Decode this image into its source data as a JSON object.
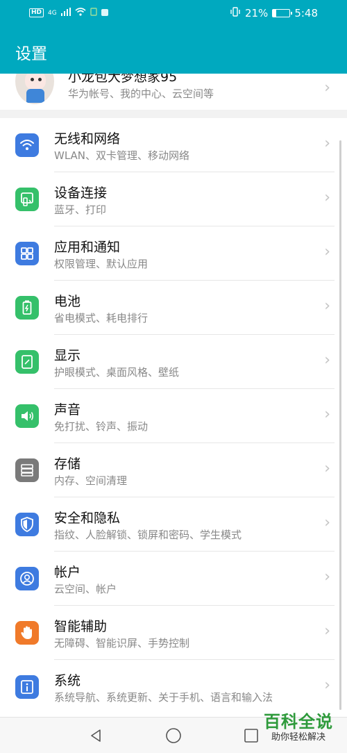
{
  "status_bar": {
    "hd": "HD",
    "network": "4G",
    "signal_icon": "signal-bars-icon",
    "wifi_icon": "wifi-icon",
    "vibrate_icon": "vibrate-icon",
    "battery_text": "21%",
    "battery_level": 0.21,
    "time": "5:48"
  },
  "app_bar": {
    "title": "设置"
  },
  "account": {
    "name": "小龙包大梦想家95",
    "subtitle": "华为帐号、我的中心、云空间等"
  },
  "menu": [
    {
      "label": "无线和网络",
      "sub": "WLAN、双卡管理、移动网络",
      "icon": "wifi-icon",
      "color": "#3e7be0"
    },
    {
      "label": "设备连接",
      "sub": "蓝牙、打印",
      "icon": "device-connection-icon",
      "color": "#35c06a"
    },
    {
      "label": "应用和通知",
      "sub": "权限管理、默认应用",
      "icon": "apps-grid-icon",
      "color": "#3e7be0"
    },
    {
      "label": "电池",
      "sub": "省电模式、耗电排行",
      "icon": "battery-icon",
      "color": "#35c06a"
    },
    {
      "label": "显示",
      "sub": "护眼模式、桌面风格、壁纸",
      "icon": "display-icon",
      "color": "#35c06a"
    },
    {
      "label": "声音",
      "sub": "免打扰、铃声、振动",
      "icon": "speaker-icon",
      "color": "#35c06a"
    },
    {
      "label": "存储",
      "sub": "内存、空间清理",
      "icon": "storage-icon",
      "color": "#7a7a7a"
    },
    {
      "label": "安全和隐私",
      "sub": "指纹、人脸解锁、锁屏和密码、学生模式",
      "icon": "shield-icon",
      "color": "#3e7be0"
    },
    {
      "label": "帐户",
      "sub": "云空间、帐户",
      "icon": "user-icon",
      "color": "#3e7be0"
    },
    {
      "label": "智能辅助",
      "sub": "无障碍、智能识屏、手势控制",
      "icon": "hand-icon",
      "color": "#f07a2a"
    },
    {
      "label": "系统",
      "sub": "系统导航、系统更新、关于手机、语言和输入法",
      "icon": "info-icon",
      "color": "#3e7be0"
    }
  ],
  "nav_bar": {
    "back_icon": "back-triangle-icon",
    "home_icon": "home-circle-icon",
    "recents_icon": "recents-square-icon"
  },
  "watermark": {
    "title": "百科全说",
    "tagline": "助你轻松解决"
  }
}
